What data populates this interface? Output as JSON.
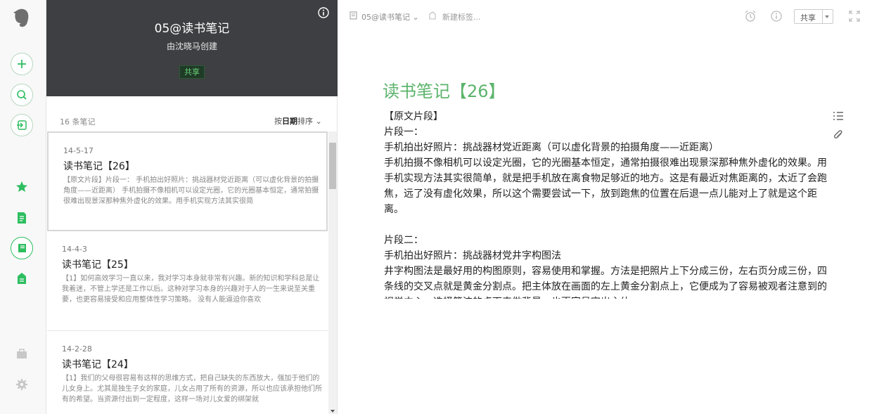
{
  "header": {
    "title": "05@读书笔记",
    "creator": "由沈晓马创建",
    "share_label": "共享"
  },
  "list": {
    "count_label": "16 条笔记",
    "sort_prefix": "按",
    "sort_key": "日期",
    "sort_suffix": "排序",
    "notes": [
      {
        "date": "14-5-17",
        "title": "读书笔记【26】",
        "snippet": "【原文片段】片段一： 手机拍出好照片：挑战器材党近距离（可以虚化背景的拍摄角度——近距离） 手机拍摄不像相机可以设定光圈，它的光圈基本恒定，通常拍摄很难出现景深那种焦外虚化的效果。用手机实现方法其实很简"
      },
      {
        "date": "14-4-3",
        "title": "读书笔记【25】",
        "snippet": "【1】如何高效学习一直以来，我对学习本身就非常有兴趣。新的知识和学科总是让我着迷，不管上学还是工作以后。这种对学习本身的兴趣对于人的一生来说至关重要，也更容易接受和应用整体性学习策略。 没有人能逼迫你喜欢"
      },
      {
        "date": "14-2-28",
        "title": "读书笔记【24】",
        "snippet": "【1】我们的父母很容易有这样的思维方式，把自己缺失的东西放大，强加于他们的儿女身上。尤其是独生子女的家庭，儿女占用了所有的资源，所以也应该承担他们所有的希望。当资源付出到一定程度，这样一场对儿女爱的绑架就"
      }
    ]
  },
  "editor": {
    "notebook_name": "05@读书笔记",
    "tag_placeholder": "新建标签...",
    "share_label": "共享",
    "title": "读书笔记【26】",
    "paragraphs": [
      "【原文片段】",
      "片段一：",
      "手机拍出好照片：挑战器材党近距离（可以虚化背景的拍摄角度——近距离）",
      "手机拍摄不像相机可以设定光圈，它的光圈基本恒定，通常拍摄很难出现景深那种焦外虚化的效果。用手机实现方法其实很简单，就是把手机放在离食物足够近的地方。这是有最近对焦距离的，太近了会跑焦，远了没有虚化效果，所以这个需要尝试一下，放到跑焦的位置在后退一点儿能对上了就是这个距离。",
      "",
      "片段二：",
      "手机拍出好照片：挑战器材党井字构图法",
      "井字构图法是最好用的构图原则，容易使用和掌握。方法是把照片上下分成三份，左右页分成三份，四条线的交叉点就是黄金分割点。把主体放在画面的左上黄金分割点上，它便成为了容易被观者注意到的视觉中心。选择简洁的桌面来做背景，也更容易突出主体。"
    ]
  },
  "colors": {
    "accent": "#5cb46c",
    "rail_icon": "#2dbe60",
    "header_bg": "#3d3f42"
  }
}
